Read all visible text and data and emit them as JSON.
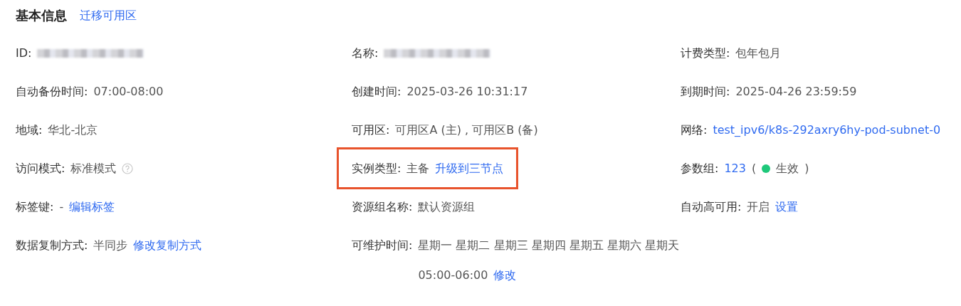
{
  "header": {
    "title": "基本信息",
    "link": "迁移可用区"
  },
  "rows": [
    [
      {
        "label": "ID:",
        "highlighted": false,
        "lines": [
          [
            {
              "kind": "redacted"
            }
          ]
        ]
      },
      {
        "label": "名称:",
        "highlighted": false,
        "lines": [
          [
            {
              "kind": "redacted"
            }
          ]
        ]
      },
      {
        "label": "计费类型:",
        "highlighted": false,
        "lines": [
          [
            {
              "kind": "text",
              "text": "包年包月"
            }
          ]
        ]
      }
    ],
    [
      {
        "label": "自动备份时间:",
        "highlighted": false,
        "lines": [
          [
            {
              "kind": "text",
              "text": "07:00-08:00"
            }
          ]
        ]
      },
      {
        "label": "创建时间:",
        "highlighted": false,
        "lines": [
          [
            {
              "kind": "text",
              "text": "2025-03-26 10:31:17"
            }
          ]
        ]
      },
      {
        "label": "到期时间:",
        "highlighted": false,
        "lines": [
          [
            {
              "kind": "text",
              "text": "2025-04-26 23:59:59"
            }
          ]
        ]
      }
    ],
    [
      {
        "label": "地域:",
        "highlighted": false,
        "lines": [
          [
            {
              "kind": "text",
              "text": "华北-北京"
            }
          ]
        ]
      },
      {
        "label": "可用区:",
        "highlighted": false,
        "lines": [
          [
            {
              "kind": "text",
              "text": "可用区A (主) , 可用区B (备)"
            }
          ]
        ]
      },
      {
        "label": "网络:",
        "highlighted": false,
        "lines": [
          [
            {
              "kind": "link",
              "text": "test_ipv6/k8s-292axry6hy-pod-subnet-0"
            }
          ]
        ]
      }
    ],
    [
      {
        "label": "访问模式:",
        "highlighted": false,
        "lines": [
          [
            {
              "kind": "text",
              "text": "标准模式"
            },
            {
              "kind": "help"
            }
          ]
        ]
      },
      {
        "label": "实例类型:",
        "highlighted": true,
        "lines": [
          [
            {
              "kind": "text",
              "text": "主备"
            },
            {
              "kind": "link",
              "text": "升级到三节点"
            }
          ]
        ]
      },
      {
        "label": "参数组:",
        "highlighted": false,
        "lines": [
          [
            {
              "kind": "link",
              "text": "123"
            },
            {
              "kind": "text",
              "text": "("
            },
            {
              "kind": "status",
              "text": "生效",
              "color": "#1ec87a"
            },
            {
              "kind": "text",
              "text": ")"
            }
          ]
        ]
      }
    ],
    [
      {
        "label": "标签键:",
        "highlighted": false,
        "lines": [
          [
            {
              "kind": "text",
              "text": "-"
            },
            {
              "kind": "link",
              "text": "编辑标签"
            }
          ]
        ]
      },
      {
        "label": "资源组名称:",
        "highlighted": false,
        "lines": [
          [
            {
              "kind": "text",
              "text": "默认资源组"
            }
          ]
        ]
      },
      {
        "label": "自动高可用:",
        "highlighted": false,
        "lines": [
          [
            {
              "kind": "text",
              "text": "开启"
            },
            {
              "kind": "link",
              "text": "设置"
            }
          ]
        ]
      }
    ],
    [
      {
        "label": "数据复制方式:",
        "highlighted": false,
        "lines": [
          [
            {
              "kind": "text",
              "text": "半同步"
            },
            {
              "kind": "link",
              "text": "修改复制方式"
            }
          ]
        ]
      },
      {
        "label": "可维护时间:",
        "highlighted": false,
        "lines": [
          [
            {
              "kind": "text",
              "text": "星期一 星期二 星期三 星期四 星期五 星期六 星期天"
            }
          ],
          [
            {
              "kind": "text",
              "text": "05:00-06:00"
            },
            {
              "kind": "link",
              "text": "修改"
            }
          ]
        ]
      }
    ]
  ]
}
